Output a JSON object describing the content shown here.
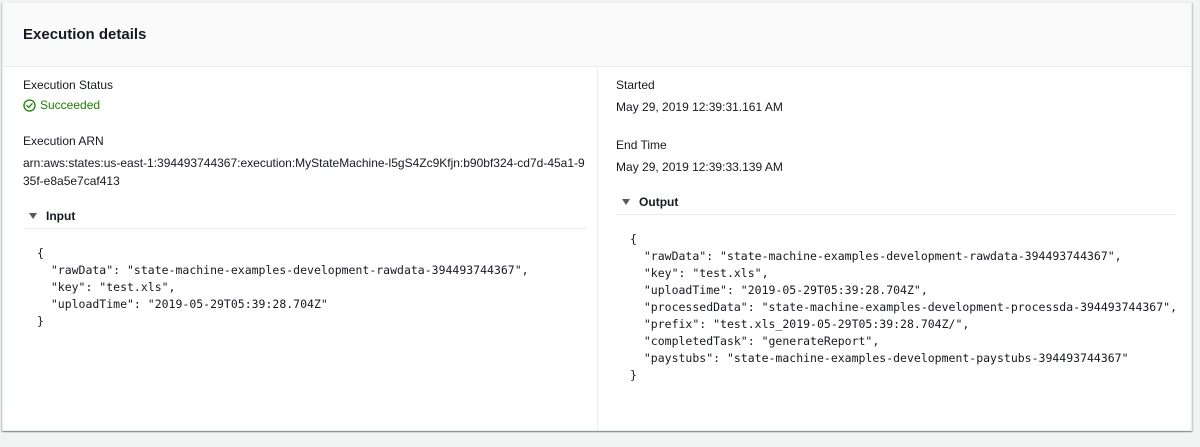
{
  "panel": {
    "title": "Execution details"
  },
  "left": {
    "status_label": "Execution Status",
    "status_value": "Succeeded",
    "arn_label": "Execution ARN",
    "arn_value": "arn:aws:states:us-east-1:394493744367:execution:MyStateMachine-l5gS4Zc9Kfjn:b90bf324-cd7d-45a1-935f-e8a5e7caf413",
    "input_label": "Input",
    "input_json": "{\n  \"rawData\": \"state-machine-examples-development-rawdata-394493744367\",\n  \"key\": \"test.xls\",\n  \"uploadTime\": \"2019-05-29T05:39:28.704Z\"\n}"
  },
  "right": {
    "started_label": "Started",
    "started_value": "May 29, 2019 12:39:31.161 AM",
    "end_label": "End Time",
    "end_value": "May 29, 2019 12:39:33.139 AM",
    "output_label": "Output",
    "output_json": "{\n  \"rawData\": \"state-machine-examples-development-rawdata-394493744367\",\n  \"key\": \"test.xls\",\n  \"uploadTime\": \"2019-05-29T05:39:28.704Z\",\n  \"processedData\": \"state-machine-examples-development-processda-394493744367\",\n  \"prefix\": \"test.xls_2019-05-29T05:39:28.704Z/\",\n  \"completedTask\": \"generateReport\",\n  \"paystubs\": \"state-machine-examples-development-paystubs-394493744367\"\n}"
  },
  "icons": {
    "status": "check-circle-icon",
    "expander": "caret-down-icon"
  },
  "colors": {
    "success": "#1d8102",
    "border": "#eaeded",
    "header_bg": "#fafafa",
    "page_bg": "#f2f3f3"
  }
}
